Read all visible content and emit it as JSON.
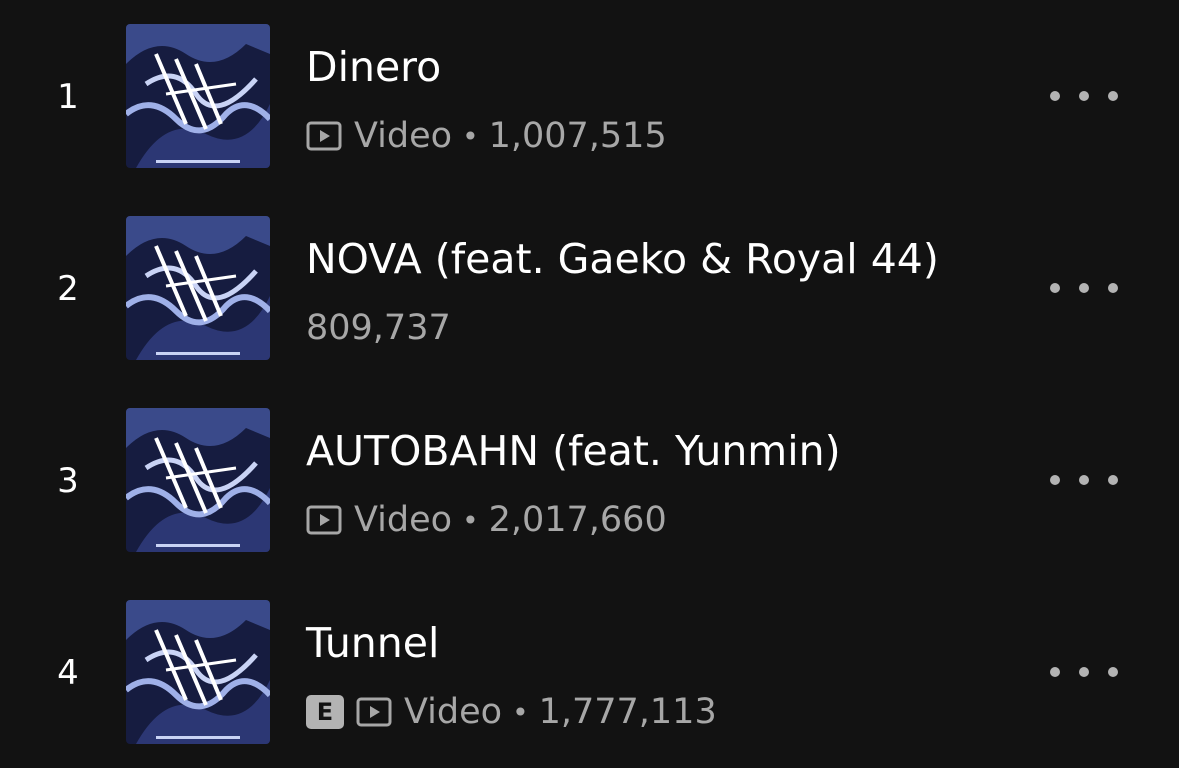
{
  "tracks": [
    {
      "rank": "1",
      "title": "Dinero",
      "has_video": true,
      "video_label": "Video",
      "separator": "•",
      "plays": "1,007,515",
      "explicit": false
    },
    {
      "rank": "2",
      "title": "NOVA (feat. Gaeko & Royal 44)",
      "has_video": false,
      "plays": "809,737",
      "explicit": false
    },
    {
      "rank": "3",
      "title": "AUTOBAHN (feat. Yunmin)",
      "has_video": true,
      "video_label": "Video",
      "separator": "•",
      "plays": "2,017,660",
      "explicit": false
    },
    {
      "rank": "4",
      "title": "Tunnel",
      "has_video": true,
      "video_label": "Video",
      "separator": "•",
      "plays": "1,777,113",
      "explicit": true,
      "explicit_label": "E"
    }
  ],
  "icons": {
    "video": "video-play-icon",
    "more": "more-options-icon",
    "explicit": "explicit-badge"
  },
  "colors": {
    "background": "#121212",
    "primary_text": "#ffffff",
    "secondary_text": "#a7a7a7",
    "badge": "#b3b3b3"
  }
}
